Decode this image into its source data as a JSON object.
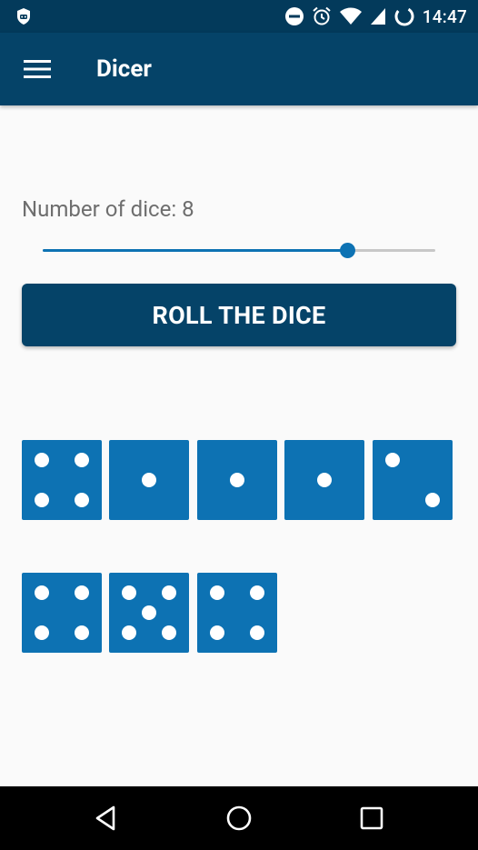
{
  "status_bar": {
    "time": "14:47",
    "icons": [
      "shield-icon",
      "do-not-disturb-icon",
      "alarm-icon",
      "wifi-icon",
      "cellular-signal-icon",
      "battery-loading-icon"
    ]
  },
  "app_bar": {
    "title": "Dicer",
    "menu_icon": "hamburger-menu-icon"
  },
  "main": {
    "dice_count_label": "Number of dice: 8",
    "slider_fraction": 0.777,
    "roll_button_label": "ROLL THE DICE",
    "dice": [
      4,
      1,
      1,
      1,
      2,
      4,
      5,
      4
    ]
  },
  "nav_bar": {
    "buttons": [
      "back-icon",
      "home-icon",
      "recents-icon"
    ]
  },
  "colors": {
    "status_bar": "#033a5b",
    "app_bar": "#054368",
    "accent": "#0d72b3",
    "background": "#fafafa",
    "label_text": "#6e6e6e"
  }
}
